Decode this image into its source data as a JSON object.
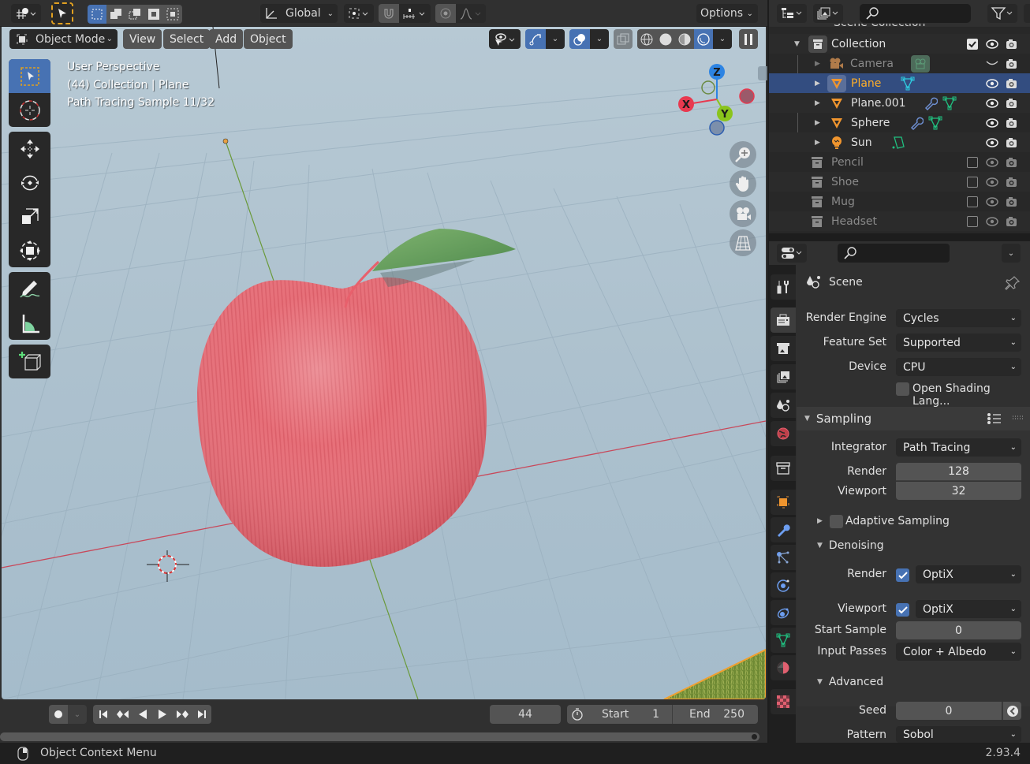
{
  "viewport_header": {
    "transform_orientation": "Global",
    "options_label": "Options"
  },
  "viewport_menu": {
    "mode": "Object Mode",
    "items": [
      "View",
      "Select",
      "Add",
      "Object"
    ]
  },
  "viewport_overlay_text": {
    "line1": "User Perspective",
    "line2": "(44) Collection | Plane",
    "line3": "Path Tracing Sample 11/32"
  },
  "gizmo": {
    "x": "X",
    "y": "Y",
    "z": "Z"
  },
  "timeline": {
    "current_frame": "44",
    "start_label": "Start",
    "start_value": "1",
    "end_label": "End",
    "end_value": "250"
  },
  "status_bar": {
    "hint": "Object Context Menu",
    "version": "2.93.4"
  },
  "outliner": {
    "search_placeholder": "",
    "scene_collection": "Scene Collection",
    "rows": [
      {
        "label": "Collection",
        "type": "collection",
        "checked": true
      },
      {
        "label": "Camera",
        "type": "camera"
      },
      {
        "label": "Plane",
        "type": "mesh",
        "selected": true
      },
      {
        "label": "Plane.001",
        "type": "mesh"
      },
      {
        "label": "Sphere",
        "type": "mesh"
      },
      {
        "label": "Sun",
        "type": "light"
      },
      {
        "label": "Pencil",
        "type": "collection",
        "checked": false
      },
      {
        "label": "Shoe",
        "type": "collection",
        "checked": false
      },
      {
        "label": "Mug",
        "type": "collection",
        "checked": false
      },
      {
        "label": "Headset",
        "type": "collection",
        "checked": false
      }
    ]
  },
  "properties": {
    "context": "Scene",
    "render_engine_label": "Render Engine",
    "render_engine": "Cycles",
    "feature_set_label": "Feature Set",
    "feature_set": "Supported",
    "device_label": "Device",
    "device": "CPU",
    "osl_label": "Open Shading Lang...",
    "osl_checked": false,
    "sampling": {
      "title": "Sampling",
      "integrator_label": "Integrator",
      "integrator": "Path Tracing",
      "render_label": "Render",
      "render_samples": "128",
      "viewport_label": "Viewport",
      "viewport_samples": "32",
      "adaptive_label": "Adaptive Sampling",
      "adaptive_checked": false
    },
    "denoising": {
      "title": "Denoising",
      "render_label": "Render",
      "render_checked": true,
      "render_denoiser": "OptiX",
      "viewport_label": "Viewport",
      "viewport_checked": true,
      "viewport_denoiser": "OptiX",
      "start_sample_label": "Start Sample",
      "start_sample": "0",
      "input_passes_label": "Input Passes",
      "input_passes": "Color + Albedo"
    },
    "advanced": {
      "title": "Advanced",
      "seed_label": "Seed",
      "seed": "0",
      "pattern_label": "Pattern",
      "pattern": "Sobol"
    }
  },
  "colors": {
    "accent_blue": "#4772b3",
    "selection_row": "#334d80",
    "selected_text": "#ffaf29",
    "x_axis": "#e8394f",
    "y_axis": "#8ac41c",
    "z_axis": "#2d84e3"
  }
}
